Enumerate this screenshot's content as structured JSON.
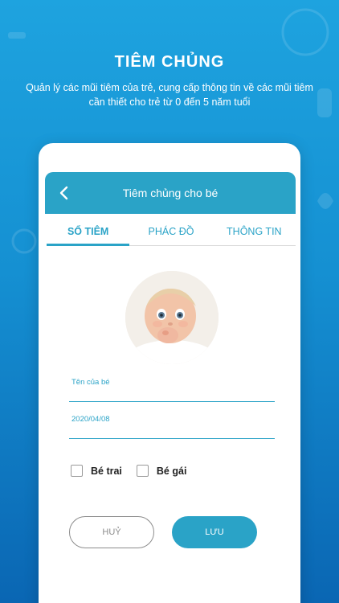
{
  "promo": {
    "title": "TIÊM CHỦNG",
    "subtitle": "Quản lý các mũi tiêm của trẻ, cung cấp thông tin về các mũi tiêm cần thiết cho trẻ từ 0 đến 5 năm tuổi"
  },
  "header": {
    "back_icon": "chevron-left-icon",
    "title": "Tiêm chủng cho bé"
  },
  "tabs": [
    {
      "label": "SỔ TIÊM",
      "active": true
    },
    {
      "label": "PHÁC ĐỒ",
      "active": false
    },
    {
      "label": "THÔNG TIN",
      "active": false
    }
  ],
  "form": {
    "name_placeholder": "Tên của bé",
    "name_value": "",
    "birthdate_value": "2020/04/08",
    "gender_options": [
      {
        "label": "Bé trai",
        "checked": false
      },
      {
        "label": "Bé gái",
        "checked": false
      }
    ]
  },
  "buttons": {
    "cancel_label": "HUỶ",
    "save_label": "LƯU"
  },
  "colors": {
    "accent": "#2aa3c7",
    "background_top": "#1ea3df",
    "background_bottom": "#0a66b3"
  }
}
